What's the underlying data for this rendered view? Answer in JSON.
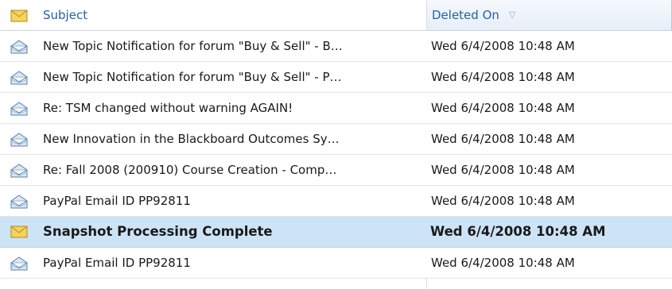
{
  "header": {
    "icon": "envelope-icon",
    "subject_label": "Subject",
    "deleted_label": "Deleted On",
    "sort_indicator": "▽"
  },
  "colors": {
    "header_text": "#2163a8",
    "selected_row": "#cde4f7",
    "closed_envelope": "#f4d35e",
    "open_envelope": "#8fb4d9"
  },
  "rows": [
    {
      "subject": "New Topic Notification for forum \"Buy & Sell\" - B…",
      "deleted_on": "Wed 6/4/2008 10:48 AM",
      "icon": "opened-envelope-icon",
      "selected": false
    },
    {
      "subject": "New Topic Notification for forum \"Buy & Sell\" - P…",
      "deleted_on": "Wed 6/4/2008 10:48 AM",
      "icon": "opened-envelope-icon",
      "selected": false
    },
    {
      "subject": "Re: TSM changed without warning AGAIN!",
      "deleted_on": "Wed 6/4/2008 10:48 AM",
      "icon": "opened-envelope-icon",
      "selected": false
    },
    {
      "subject": "New Innovation in the Blackboard Outcomes Sy…",
      "deleted_on": "Wed 6/4/2008 10:48 AM",
      "icon": "opened-envelope-icon",
      "selected": false
    },
    {
      "subject": "Re: Fall 2008 (200910) Course Creation - Comp…",
      "deleted_on": "Wed 6/4/2008 10:48 AM",
      "icon": "opened-envelope-icon",
      "selected": false
    },
    {
      "subject": "PayPal Email ID PP92811",
      "deleted_on": "Wed 6/4/2008 10:48 AM",
      "icon": "opened-envelope-icon",
      "selected": false
    },
    {
      "subject": "Snapshot Processing Complete",
      "deleted_on": "Wed 6/4/2008 10:48 AM",
      "icon": "unread-envelope-icon",
      "selected": true
    },
    {
      "subject": "PayPal Email ID PP92811",
      "deleted_on": "Wed 6/4/2008 10:48 AM",
      "icon": "opened-envelope-icon",
      "selected": false
    }
  ]
}
